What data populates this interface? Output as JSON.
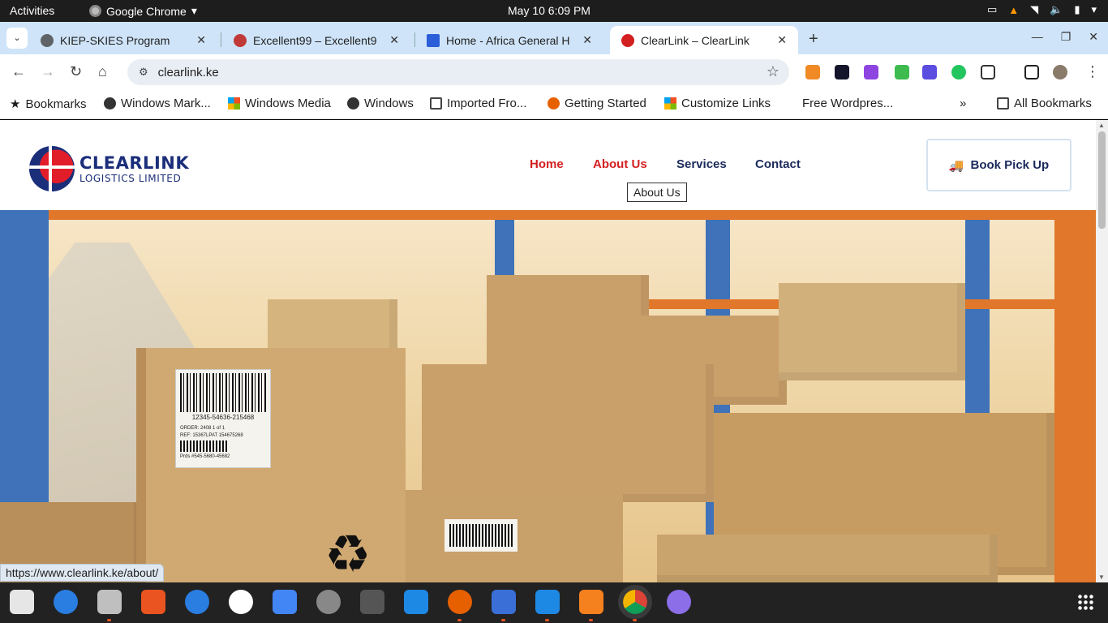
{
  "system_bar": {
    "activities": "Activities",
    "app_name": "Google Chrome",
    "clock": "May 10    6:09 PM"
  },
  "browser": {
    "tabs": [
      {
        "title": "KIEP-SKIES Program",
        "favicon_color": "#5f6368",
        "active": false
      },
      {
        "title": "Excellent99 – Excellent9",
        "favicon_color": "#c13a3a",
        "active": false
      },
      {
        "title": "Home - Africa General H",
        "favicon_color": "#2b5fd9",
        "active": false
      },
      {
        "title": "ClearLink – ClearLink",
        "favicon_color": "#d31f1f",
        "active": true
      }
    ],
    "url": "clearlink.ke",
    "bookmarks": [
      {
        "label": "Bookmarks",
        "icon": "star-icon"
      },
      {
        "label": "Windows Mark...",
        "icon": "globe-icon"
      },
      {
        "label": "Windows Media",
        "icon": "windows-icon"
      },
      {
        "label": "Windows",
        "icon": "globe-icon"
      },
      {
        "label": "Imported Fro...",
        "icon": "folder-icon"
      },
      {
        "label": "Getting Started",
        "icon": "firefox-icon"
      },
      {
        "label": "Customize Links",
        "icon": "windows-icon"
      },
      {
        "label": "Free Wordpres...",
        "icon": "none"
      },
      {
        "label": "»",
        "icon": "none"
      },
      {
        "label": "All Bookmarks",
        "icon": "folder-icon"
      }
    ],
    "status_url": "https://www.clearlink.ke/about/"
  },
  "site": {
    "logo_line1": "CLEARLINK",
    "logo_line2": "LOGISTICS LIMITED",
    "nav": [
      {
        "label": "Home",
        "color": "#d31f1f"
      },
      {
        "label": "About Us",
        "color": "#d31f1f"
      },
      {
        "label": "Services",
        "color": "#1b2a5b"
      },
      {
        "label": "Contact",
        "color": "#1b2a5b"
      }
    ],
    "tooltip": "About Us",
    "cta": "Book Pick Up",
    "hero": {
      "barcode_number": "12345-54636-215468",
      "label_line1": "ORDER: 2408            1 of 1",
      "label_line2": "REF: 15367LPAT           154675268",
      "label_line3": "Prds #545-5680-45682"
    }
  }
}
